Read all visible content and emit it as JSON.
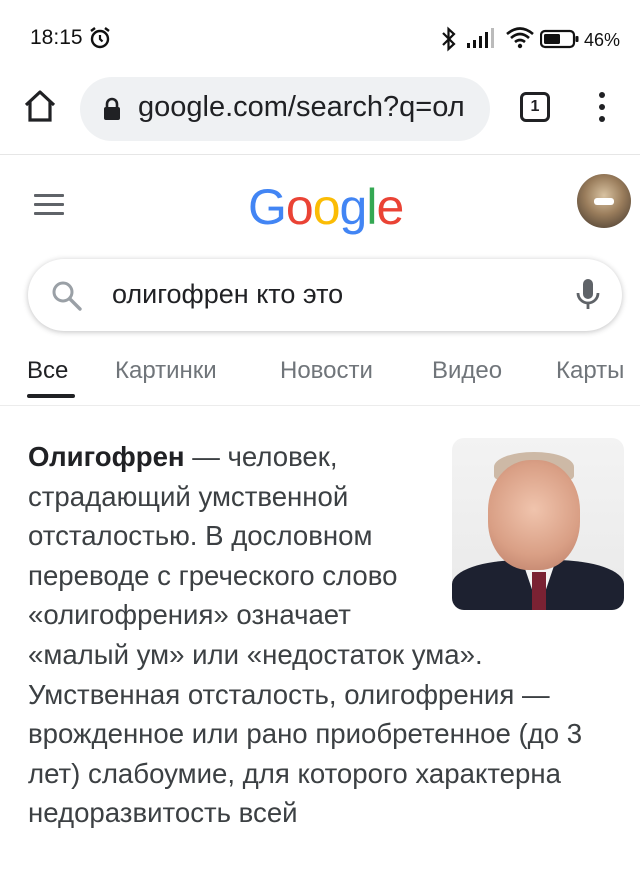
{
  "status_bar": {
    "time": "18:15",
    "battery_text": "46%"
  },
  "browser": {
    "url": "google.com/search?q=ол",
    "tab_count": "1"
  },
  "google": {
    "logo_letters": [
      "G",
      "o",
      "o",
      "g",
      "l",
      "e"
    ],
    "logo_colors": [
      "#4285F4",
      "#EA4335",
      "#FBBC05",
      "#4285F4",
      "#34A853",
      "#EA4335"
    ]
  },
  "search": {
    "query": "олигофрен кто это"
  },
  "tabs": {
    "all": "Все",
    "images": "Картинки",
    "news": "Новости",
    "video": "Видео",
    "maps": "Карты"
  },
  "result": {
    "term": "Олигофрен",
    "definition": " — человек, страдающий умственной отсталостью. В дословном переводе с греческого слово «олигофрения» означает «малый ум» или «недостаток ума». Умственная отсталость, олигофрения — врожденное или рано приобретенное (до 3 лет) слабоумие, для которого характерна недоразвитость всей"
  }
}
